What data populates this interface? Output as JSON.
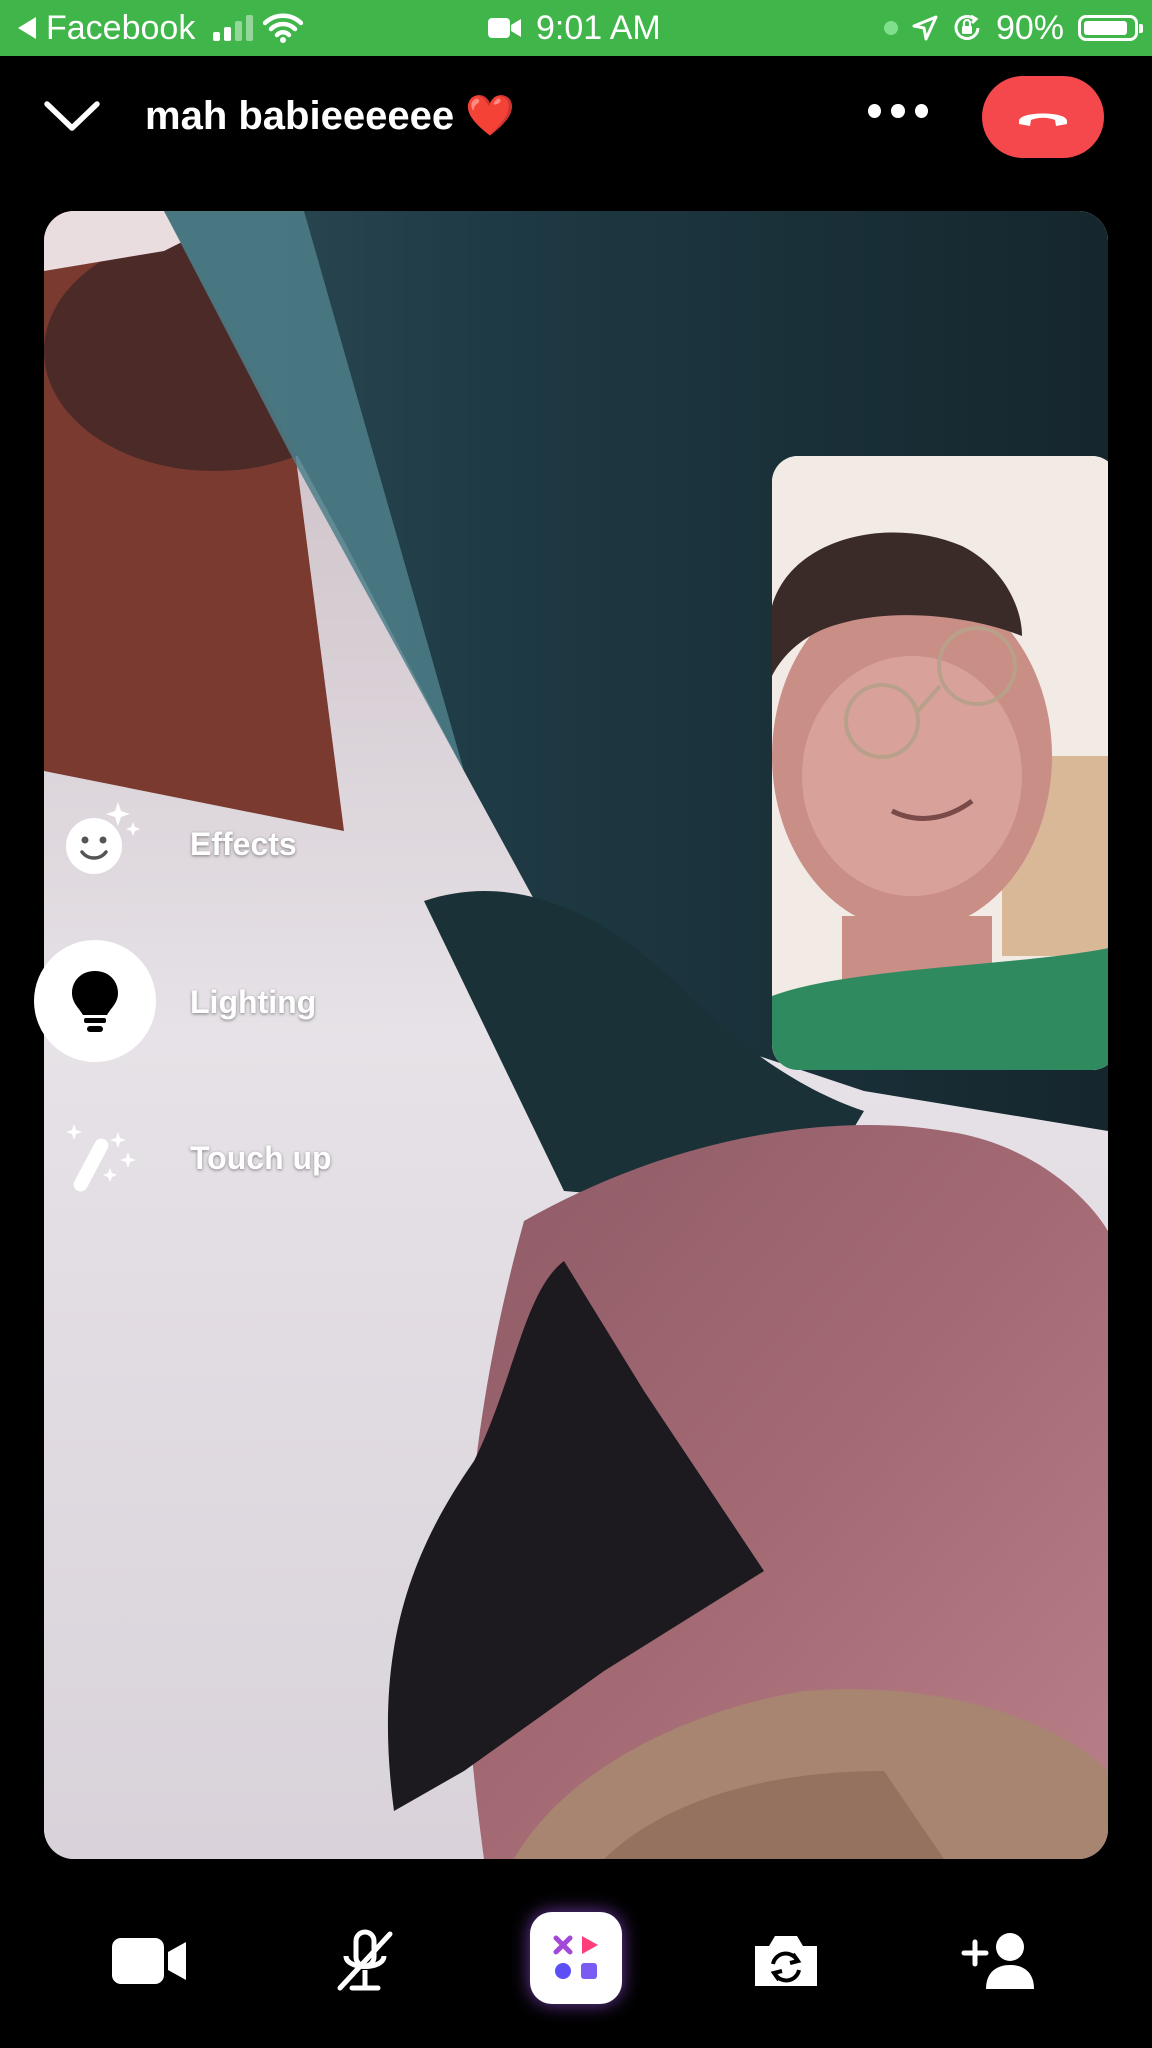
{
  "status_bar": {
    "back_app": "Facebook",
    "time": "9:01 AM",
    "battery": "90%",
    "battery_level": 0.9,
    "icons": [
      "back-arrow-icon",
      "signal-icon",
      "wifi-icon",
      "video-camera-icon",
      "green-dot-icon",
      "location-arrow-icon",
      "orientation-lock-icon",
      "battery-icon"
    ]
  },
  "header": {
    "title": "mah babieeeeee ❤️",
    "icons": [
      "chevron-down-icon",
      "more-options-icon",
      "end-call-icon"
    ],
    "colors": {
      "end_call": "#f5484c",
      "status_bar": "#3fb54a"
    }
  },
  "side_menu": {
    "effects_label": "Effects",
    "lighting_label": "Lighting",
    "touch_up_label": "Touch up",
    "icons": [
      "smiley-sparkle-icon",
      "lightbulb-icon",
      "magic-wand-icon"
    ]
  },
  "toolbar": {
    "icons": [
      "video-camera-icon",
      "microphone-muted-icon",
      "apps-icon",
      "flip-camera-icon",
      "add-person-icon"
    ]
  }
}
